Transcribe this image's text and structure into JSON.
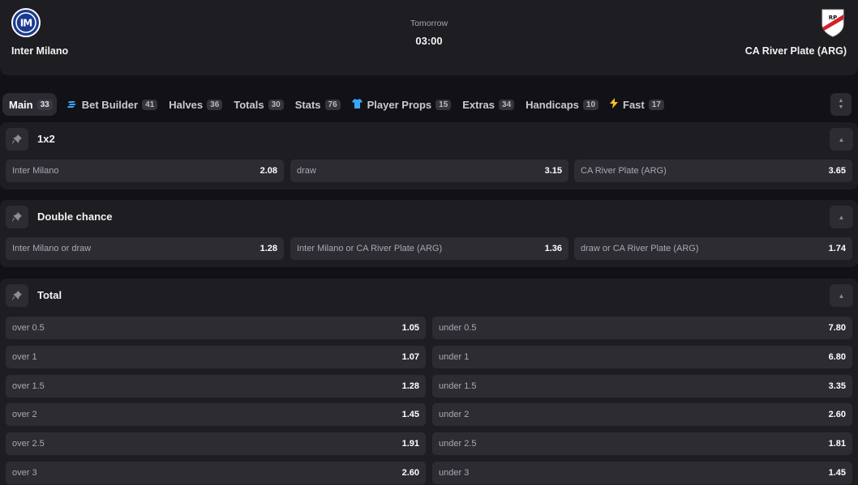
{
  "match": {
    "home_team": "Inter Milano",
    "away_team": "CA River Plate (ARG)",
    "day": "Tomorrow",
    "time": "03:00",
    "home_crest_text": "IM",
    "away_crest_text": "RP"
  },
  "tabs": [
    {
      "label": "Main",
      "count": "33",
      "icon": ""
    },
    {
      "label": "Bet Builder",
      "count": "41",
      "icon": "bet-builder-icon"
    },
    {
      "label": "Halves",
      "count": "36",
      "icon": ""
    },
    {
      "label": "Totals",
      "count": "30",
      "icon": ""
    },
    {
      "label": "Stats",
      "count": "76",
      "icon": ""
    },
    {
      "label": "Player Props",
      "count": "15",
      "icon": "jersey-icon"
    },
    {
      "label": "Extras",
      "count": "34",
      "icon": ""
    },
    {
      "label": "Handicaps",
      "count": "10",
      "icon": ""
    },
    {
      "label": "Fast",
      "count": "17",
      "icon": "lightning-icon"
    }
  ],
  "markets": {
    "m1x2": {
      "title": "1x2",
      "odds": [
        {
          "label": "Inter Milano",
          "value": "2.08"
        },
        {
          "label": "draw",
          "value": "3.15"
        },
        {
          "label": "CA River Plate (ARG)",
          "value": "3.65"
        }
      ]
    },
    "double_chance": {
      "title": "Double chance",
      "odds": [
        {
          "label": "Inter Milano or draw",
          "value": "1.28"
        },
        {
          "label": "Inter Milano or CA River Plate (ARG)",
          "value": "1.36"
        },
        {
          "label": "draw or CA River Plate (ARG)",
          "value": "1.74"
        }
      ]
    },
    "total": {
      "title": "Total",
      "rows": [
        {
          "over": {
            "label": "over 0.5",
            "value": "1.05"
          },
          "under": {
            "label": "under 0.5",
            "value": "7.80"
          }
        },
        {
          "over": {
            "label": "over 1",
            "value": "1.07"
          },
          "under": {
            "label": "under 1",
            "value": "6.80"
          }
        },
        {
          "over": {
            "label": "over 1.5",
            "value": "1.28"
          },
          "under": {
            "label": "under 1.5",
            "value": "3.35"
          }
        },
        {
          "over": {
            "label": "over 2",
            "value": "1.45"
          },
          "under": {
            "label": "under 2",
            "value": "2.60"
          }
        },
        {
          "over": {
            "label": "over 2.5",
            "value": "1.91"
          },
          "under": {
            "label": "under 2.5",
            "value": "1.81"
          }
        },
        {
          "over": {
            "label": "over 3",
            "value": "2.60"
          },
          "under": {
            "label": "under 3",
            "value": "1.45"
          }
        }
      ]
    }
  },
  "colors": {
    "background": "#121216",
    "panel": "#1d1d22",
    "odd_button": "#2c2c32",
    "accent_blue": "#3aa7ff",
    "accent_yellow": "#ffc21a"
  }
}
